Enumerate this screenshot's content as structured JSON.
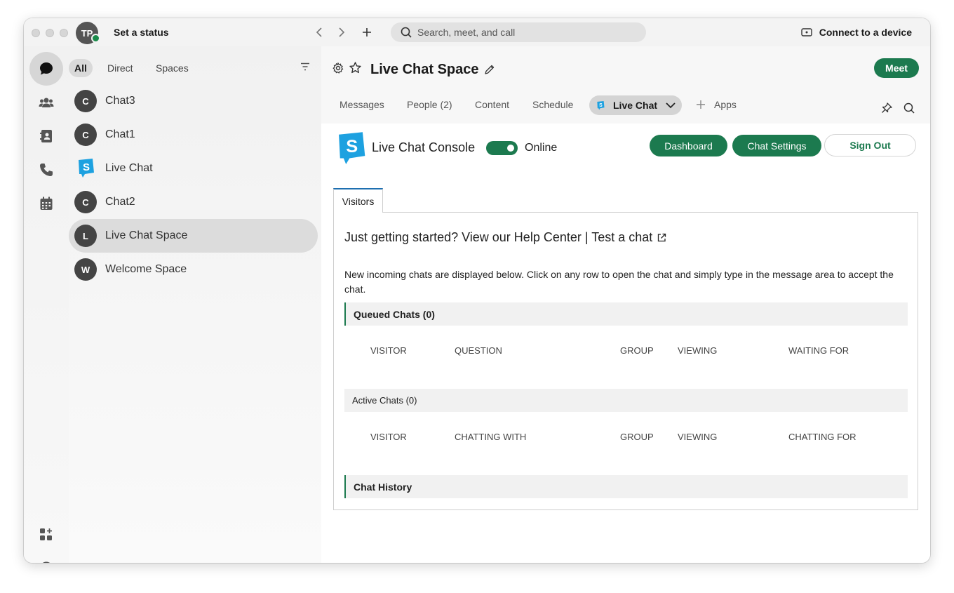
{
  "titlebar": {
    "avatar_initials": "TP",
    "set_status": "Set a status",
    "search_placeholder": "Search, meet, and call",
    "connect_device": "Connect to a device"
  },
  "filters": {
    "all": "All",
    "direct": "Direct",
    "spaces": "Spaces"
  },
  "spaces": [
    {
      "initial": "C",
      "name": "Chat3"
    },
    {
      "initial": "C",
      "name": "Chat1"
    },
    {
      "initial": "",
      "name": "Live Chat"
    },
    {
      "initial": "C",
      "name": "Chat2"
    },
    {
      "initial": "L",
      "name": "Live Chat Space"
    },
    {
      "initial": "W",
      "name": "Welcome Space"
    }
  ],
  "header": {
    "title": "Live Chat Space",
    "meet": "Meet",
    "tabs": {
      "messages": "Messages",
      "people": "People (2)",
      "content": "Content",
      "schedule": "Schedule",
      "live_chat": "Live Chat",
      "apps": "Apps"
    }
  },
  "console": {
    "title": "Live Chat Console",
    "status": "Online",
    "dashboard": "Dashboard",
    "chat_settings": "Chat Settings",
    "sign_out": "Sign Out",
    "visitors_tab": "Visitors",
    "help_text": "Just getting started? View our Help Center | Test a chat",
    "description": "New incoming chats are displayed below. Click on any row to open the chat and simply type in the message area to accept the chat.",
    "queued": {
      "label": "Queued Chats (0)",
      "columns": [
        "VISITOR",
        "QUESTION",
        "GROUP",
        "VIEWING",
        "WAITING FOR"
      ]
    },
    "active": {
      "label": "Active Chats (0)",
      "columns": [
        "VISITOR",
        "CHATTING WITH",
        "GROUP",
        "VIEWING",
        "CHATTING FOR"
      ]
    },
    "history": {
      "label": "Chat History"
    }
  },
  "colors": {
    "accent_green": "#1c7a4f",
    "tab_blue": "#1e6fb0"
  }
}
